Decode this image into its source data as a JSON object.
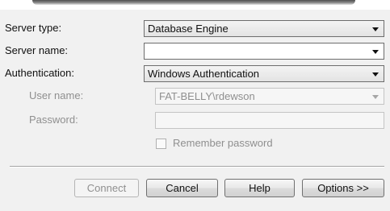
{
  "server_type": {
    "label": "Server type:",
    "value": "Database Engine"
  },
  "server_name": {
    "label": "Server name:",
    "value": ""
  },
  "authentication": {
    "label": "Authentication:",
    "value": "Windows Authentication"
  },
  "user_name": {
    "label": "User name:",
    "value": "FAT-BELLY\\rdewson"
  },
  "password": {
    "label": "Password:",
    "value": ""
  },
  "remember_password": {
    "label": "Remember password",
    "checked": false
  },
  "buttons": {
    "connect": "Connect",
    "cancel": "Cancel",
    "help": "Help",
    "options": "Options >>"
  },
  "icons": {
    "dropdown": "chevron-down-icon",
    "checkbox": "checkbox-icon"
  }
}
